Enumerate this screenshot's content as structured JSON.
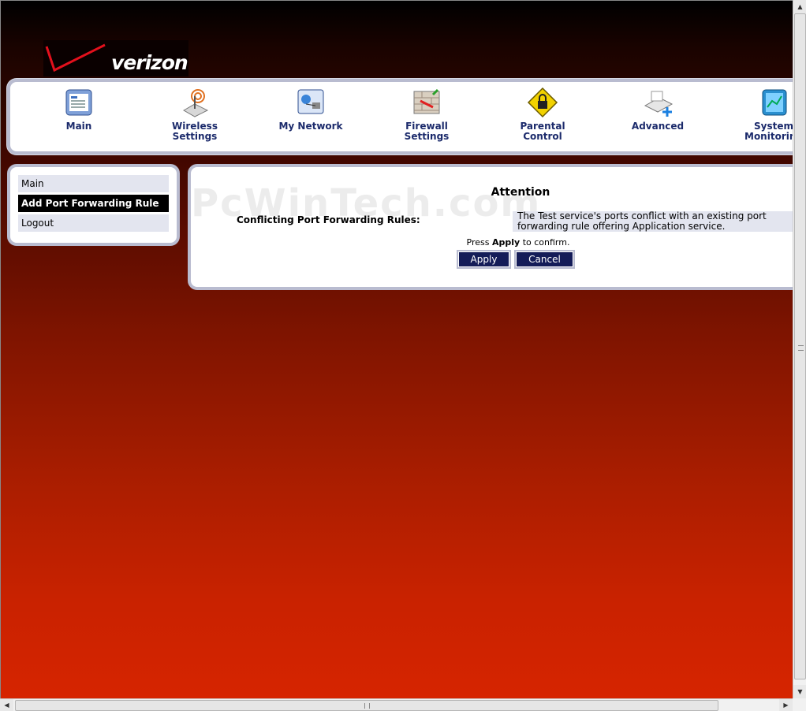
{
  "logo": {
    "text": "verizon"
  },
  "topnav": {
    "items": [
      {
        "label": "Main",
        "icon": "main-dashboard-icon"
      },
      {
        "label": "Wireless Settings",
        "icon": "wireless-antenna-icon"
      },
      {
        "label": "My Network",
        "icon": "network-icon"
      },
      {
        "label": "Firewall Settings",
        "icon": "firewall-icon"
      },
      {
        "label": "Parental Control",
        "icon": "parental-lock-icon"
      },
      {
        "label": "Advanced",
        "icon": "advanced-settings-icon"
      },
      {
        "label": "System Monitoring",
        "icon": "system-monitoring-icon"
      }
    ]
  },
  "leftmenu": {
    "items": [
      {
        "label": "Main",
        "active": false
      },
      {
        "label": "Add Port Forwarding Rule",
        "active": true
      },
      {
        "label": "Logout",
        "active": false
      }
    ]
  },
  "content": {
    "watermark": "PcWinTech.com",
    "title": "Attention",
    "conflict_label": "Conflicting Port Forwarding Rules:",
    "conflict_value": "The Test service's ports conflict with an existing port forwarding rule offering Application service.",
    "press_prefix": "Press",
    "press_bold": "Apply",
    "press_suffix": "to confirm.",
    "apply_label": "Apply",
    "cancel_label": "Cancel"
  },
  "colors": {
    "nav_label": "#1b2a6b",
    "button_bg": "#141c58",
    "panel_border": "#b9bcd0",
    "row_bg": "#e3e5ef"
  }
}
